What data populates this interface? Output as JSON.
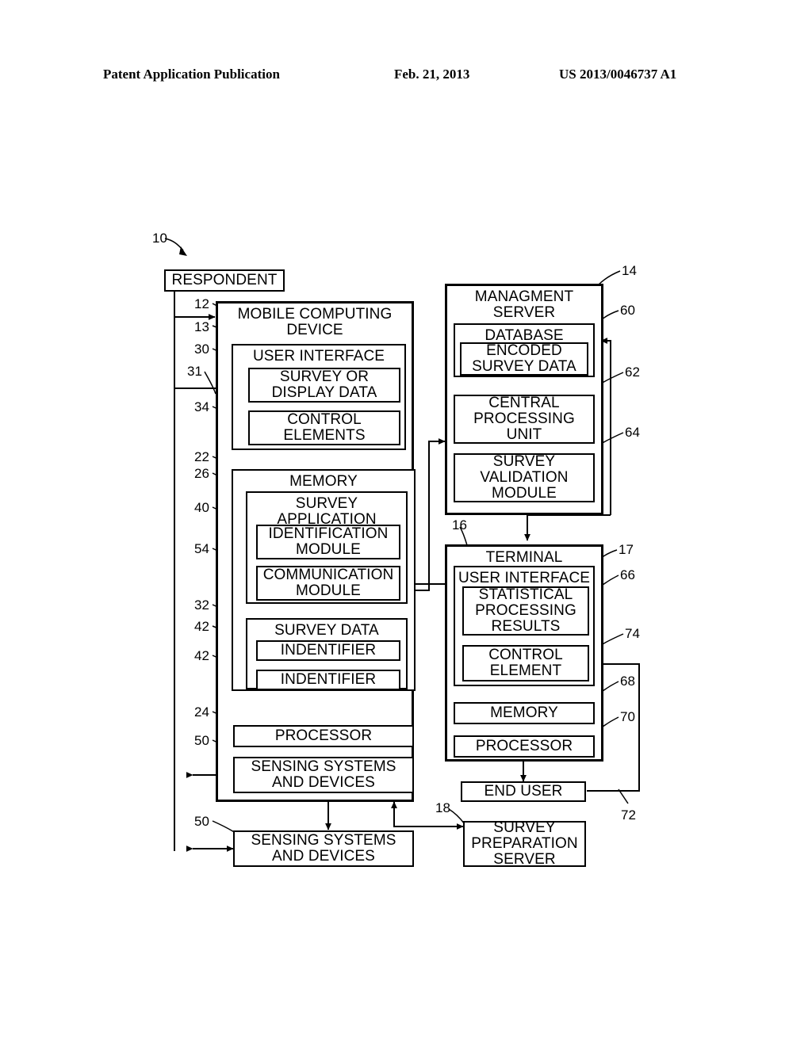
{
  "header": {
    "left": "Patent Application Publication",
    "date": "Feb. 21, 2013",
    "number": "US 2013/0046737 A1"
  },
  "figure": {
    "boxes": {
      "respondent": "RESPONDENT",
      "mobile_computing_device": "MOBILE COMPUTING DEVICE",
      "user_interface": "USER INTERFACE",
      "survey_or_display_data": "SURVEY OR DISPLAY DATA",
      "control_elements": "CONTROL ELEMENTS",
      "memory": "MEMORY",
      "survey_application": "SURVEY APPLICATION",
      "identification_module": "IDENTIFICATION MODULE",
      "communication_module": "COMMUNICATION MODULE",
      "survey_data": "SURVEY DATA",
      "identifier_1": "INDENTIFIER",
      "identifier_2": "INDENTIFIER",
      "processor": "PROCESSOR",
      "sensing_systems_1": "SENSING SYSTEMS AND DEVICES",
      "sensing_systems_2": "SENSING SYSTEMS AND DEVICES",
      "management_server": "MANAGMENT SERVER",
      "database": "DATABASE",
      "encoded_survey_data": "ENCODED SURVEY DATA",
      "central_processing_unit": "CENTRAL PROCESSING UNIT",
      "survey_validation_module": "SURVEY VALIDATION MODULE",
      "terminal": "TERMINAL",
      "terminal_user_interface": "USER INTERFACE",
      "statistical_processing_results": "STATISTICAL PROCESSING RESULTS",
      "control_element": "CONTROL ELEMENT",
      "terminal_memory": "MEMORY",
      "terminal_processor": "PROCESSOR",
      "end_user": "END USER",
      "survey_preparation_server": "SURVEY PREPARATION SERVER"
    },
    "refs": {
      "r10": "10",
      "r12": "12",
      "r13": "13",
      "r30": "30",
      "r31": "31",
      "r34": "34",
      "r22": "22",
      "r26": "26",
      "r40": "40",
      "r54": "54",
      "r32": "32",
      "r42a": "42",
      "r42b": "42",
      "r24": "24",
      "r50a": "50",
      "r50b": "50",
      "r14": "14",
      "r60": "60",
      "r62": "62",
      "r64": "64",
      "r16": "16",
      "r17": "17",
      "r66": "66",
      "r74": "74",
      "r68": "68",
      "r70": "70",
      "r72": "72",
      "r18": "18"
    }
  },
  "colors": {
    "ink": "#000000",
    "paper": "#ffffff"
  }
}
